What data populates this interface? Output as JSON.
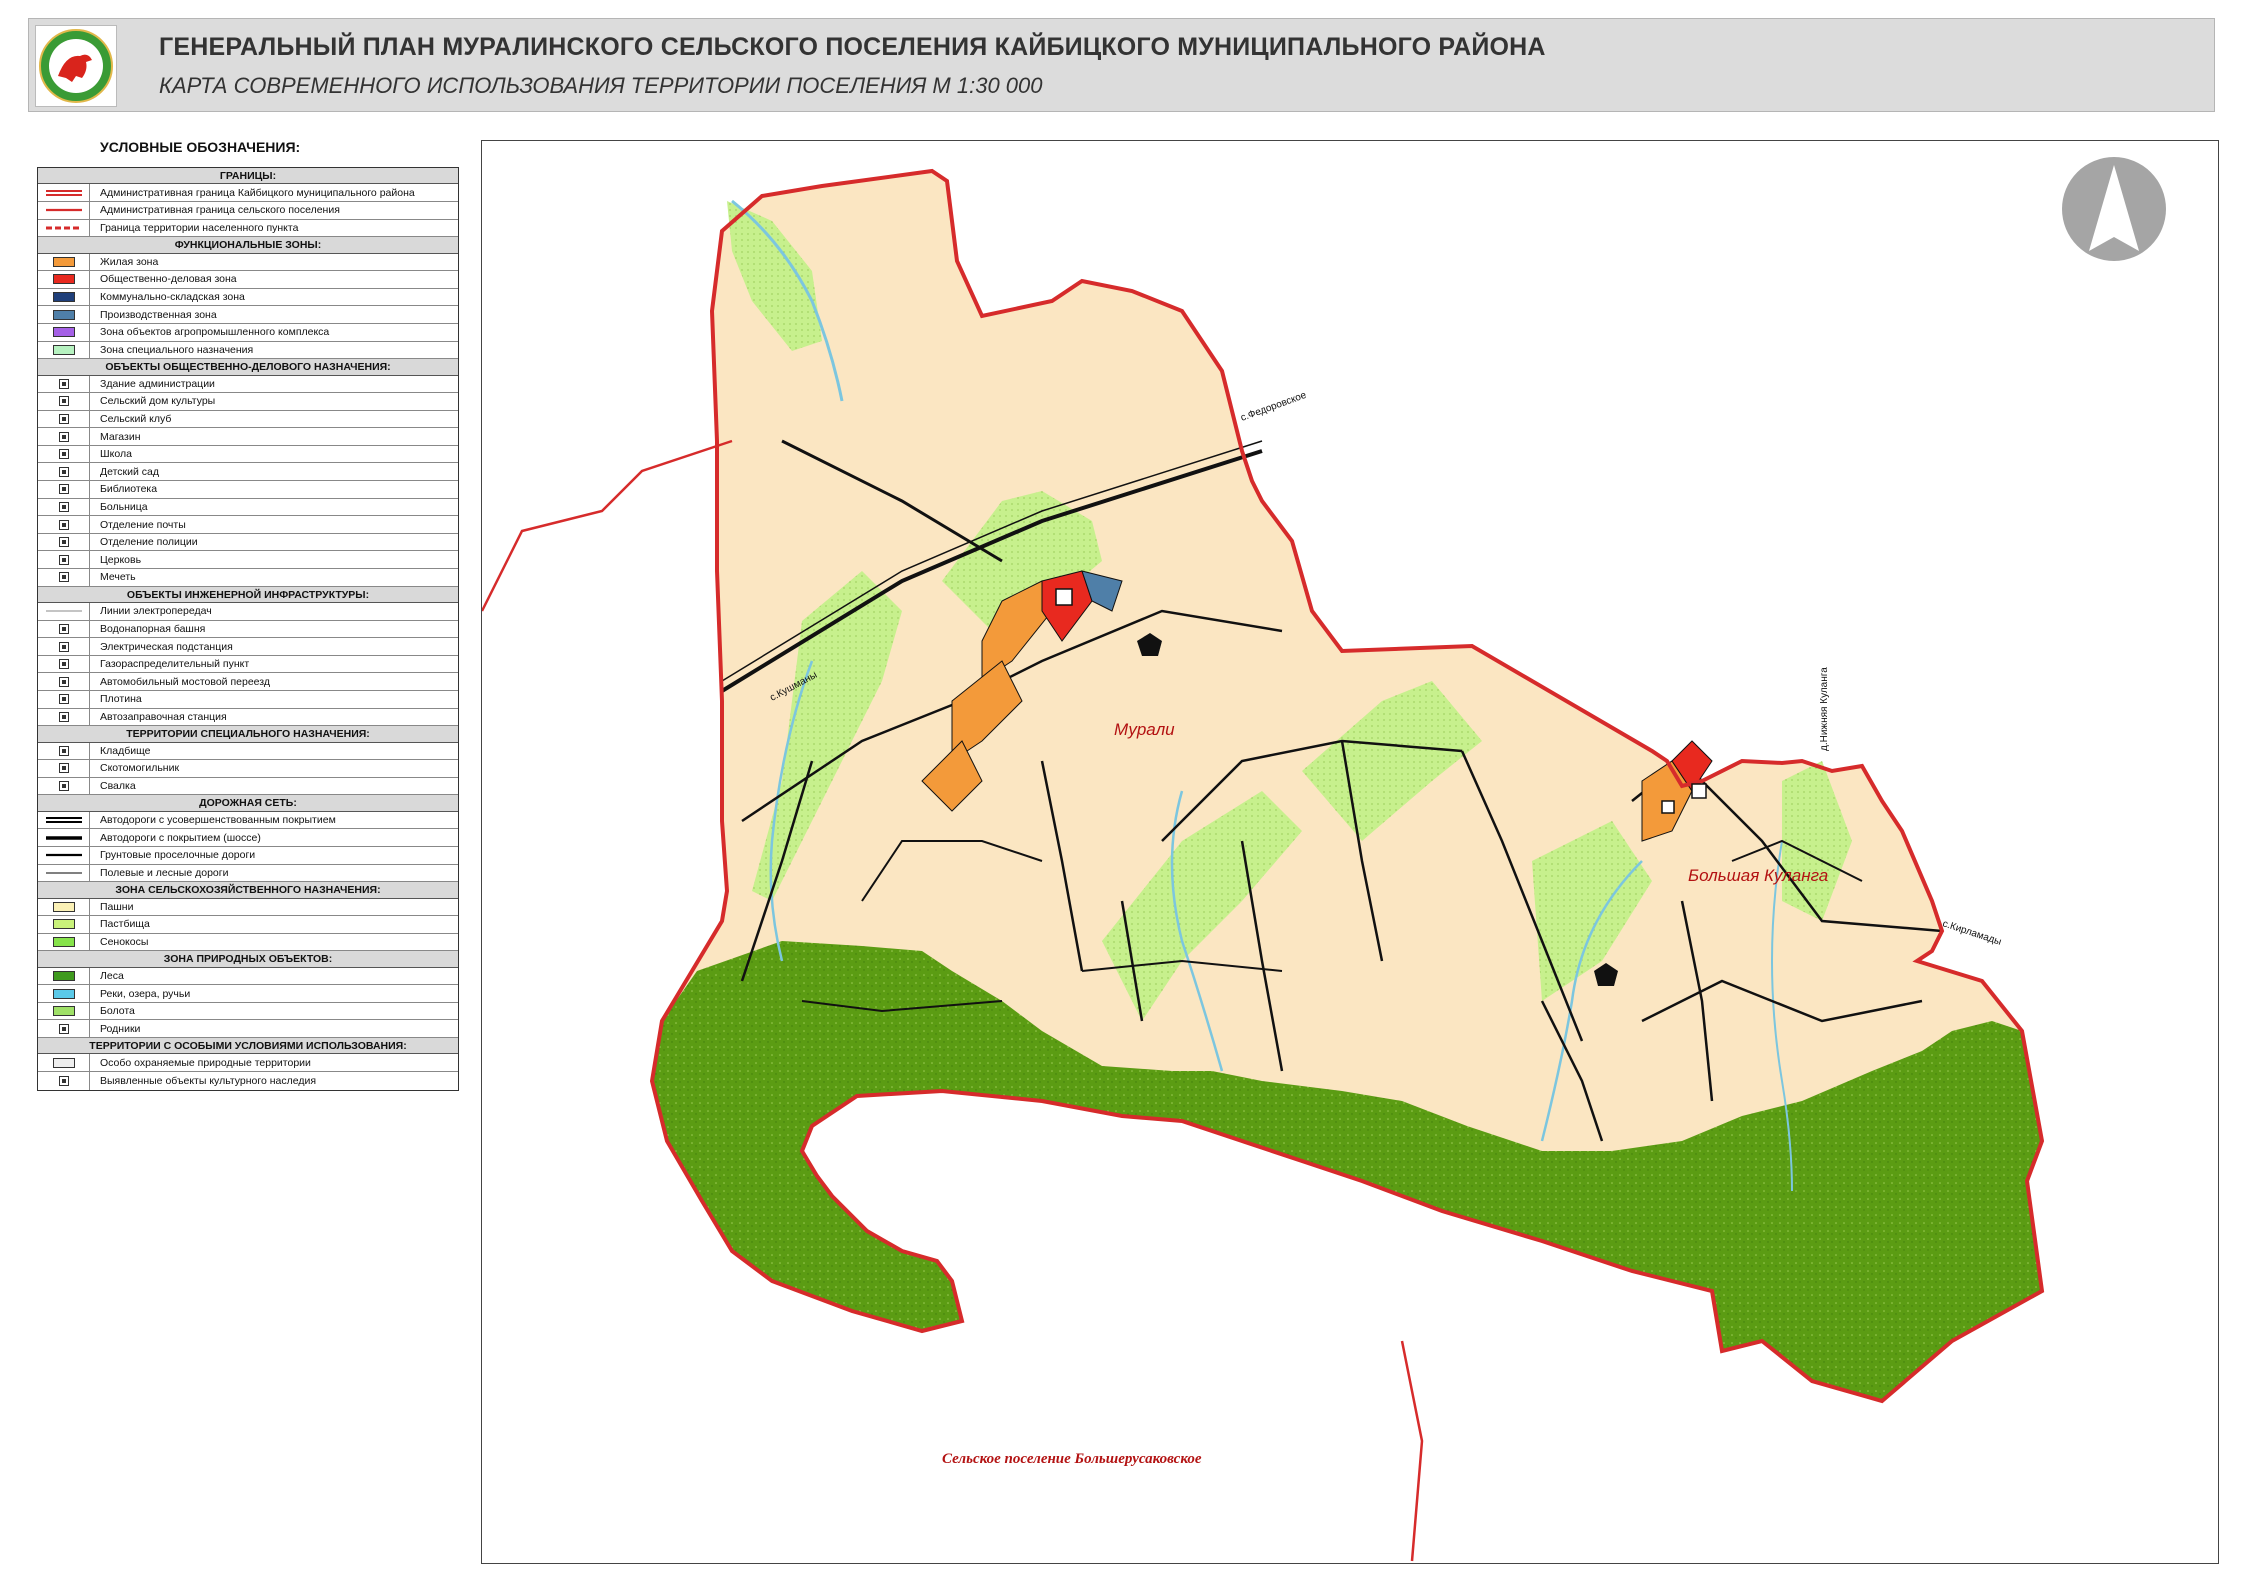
{
  "header": {
    "title": "ГЕНЕРАЛЬНЫЙ ПЛАН МУРАЛИНСКОГО СЕЛЬСКОГО ПОСЕЛЕНИЯ КАЙБИЦКОГО МУНИЦИПАЛЬНОГО РАЙОНА",
    "subtitle": "КАРТА СОВРЕМЕННОГО ИСПОЛЬЗОВАНИЯ ТЕРРИТОРИИ ПОСЕЛЕНИЯ М 1:30 000"
  },
  "legend": {
    "heading": "УСЛОВНЫЕ ОБОЗНАЧЕНИЯ:",
    "sections": [
      {
        "title": "ГРАНИЦЫ:",
        "items": [
          {
            "label": "Административная граница Кайбицкого муниципального района",
            "kind": "line",
            "color": "#d62b2b",
            "style": "double"
          },
          {
            "label": "Административная граница сельского поселения",
            "kind": "line",
            "color": "#d62b2b",
            "style": "solid"
          },
          {
            "label": "Граница территории населенного пункта",
            "kind": "line",
            "color": "#d62b2b",
            "style": "dashed"
          }
        ]
      },
      {
        "title": "ФУНКЦИОНАЛЬНЫЕ ЗОНЫ:",
        "items": [
          {
            "label": "Жилая зона",
            "kind": "box",
            "color": "#f39a3a"
          },
          {
            "label": "Общественно-деловая зона",
            "kind": "box",
            "color": "#e8291f"
          },
          {
            "label": "Коммунально-складская зона",
            "kind": "box",
            "color": "#1f3f7a"
          },
          {
            "label": "Производственная зона",
            "kind": "box",
            "color": "#4f7fa8"
          },
          {
            "label": "Зона объектов агропромышленного комплекса",
            "kind": "box",
            "color": "#a560e6"
          },
          {
            "label": "Зона специального назначения",
            "kind": "box",
            "color": "#b6f2c0"
          }
        ]
      },
      {
        "title": "ОБЪЕКТЫ ОБЩЕСТВЕННО-ДЕЛОВОГО НАЗНАЧЕНИЯ:",
        "items": [
          {
            "label": "Здание администрации",
            "kind": "icon",
            "icon": "administration-icon"
          },
          {
            "label": "Сельский дом культуры",
            "kind": "icon",
            "icon": "culture-house-icon"
          },
          {
            "label": "Сельский клуб",
            "kind": "icon",
            "icon": "club-icon"
          },
          {
            "label": "Магазин",
            "kind": "icon",
            "icon": "shop-icon"
          },
          {
            "label": "Школа",
            "kind": "icon",
            "icon": "school-icon"
          },
          {
            "label": "Детский сад",
            "kind": "icon",
            "icon": "kindergarten-icon"
          },
          {
            "label": "Библиотека",
            "kind": "icon",
            "icon": "library-icon"
          },
          {
            "label": "Больница",
            "kind": "icon",
            "icon": "hospital-icon"
          },
          {
            "label": "Отделение почты",
            "kind": "icon",
            "icon": "post-office-icon"
          },
          {
            "label": "Отделение полиции",
            "kind": "icon",
            "icon": "police-icon"
          },
          {
            "label": "Церковь",
            "kind": "icon",
            "icon": "church-icon"
          },
          {
            "label": "Мечеть",
            "kind": "icon",
            "icon": "mosque-icon"
          }
        ]
      },
      {
        "title": "ОБЪЕКТЫ ИНЖЕНЕРНОЙ ИНФРАСТРУКТУРЫ:",
        "items": [
          {
            "label": "Линии электропередач",
            "kind": "line",
            "color": "#888888",
            "style": "thin"
          },
          {
            "label": "Водонапорная башня",
            "kind": "icon",
            "icon": "water-tower-icon"
          },
          {
            "label": "Электрическая подстанция",
            "kind": "icon",
            "icon": "substation-icon"
          },
          {
            "label": "Газораспределительный пункт",
            "kind": "icon",
            "icon": "gas-point-icon"
          },
          {
            "label": "Автомобильный мостовой переезд",
            "kind": "icon",
            "icon": "bridge-icon"
          },
          {
            "label": "Плотина",
            "kind": "icon",
            "icon": "dam-icon"
          },
          {
            "label": "Автозаправочная станция",
            "kind": "icon",
            "icon": "fuel-station-icon"
          }
        ]
      },
      {
        "title": "ТЕРРИТОРИИ СПЕЦИАЛЬНОГО НАЗНАЧЕНИЯ:",
        "items": [
          {
            "label": "Кладбище",
            "kind": "icon",
            "icon": "cemetery-icon"
          },
          {
            "label": "Скотомогильник",
            "kind": "icon",
            "icon": "cattle-burial-icon"
          },
          {
            "label": "Свалка",
            "kind": "icon",
            "icon": "landfill-icon"
          }
        ]
      },
      {
        "title": "ДОРОЖНАЯ СЕТЬ:",
        "items": [
          {
            "label": "Автодороги с усовершенствованным покрытием",
            "kind": "line",
            "color": "#000000",
            "style": "double"
          },
          {
            "label": "Автодороги с покрытием (шоссе)",
            "kind": "line",
            "color": "#000000",
            "style": "thick"
          },
          {
            "label": "Грунтовые проселочные дороги",
            "kind": "line",
            "color": "#000000",
            "style": "solid"
          },
          {
            "label": "Полевые и лесные дороги",
            "kind": "line",
            "color": "#000000",
            "style": "thin"
          }
        ]
      },
      {
        "title": "ЗОНА СЕЛЬСКОХОЗЯЙСТВЕННОГО НАЗНАЧЕНИЯ:",
        "items": [
          {
            "label": "Пашни",
            "kind": "box",
            "color": "#fbf1b6"
          },
          {
            "label": "Пастбища",
            "kind": "box",
            "color": "#c9f27a"
          },
          {
            "label": "Сенокосы",
            "kind": "box",
            "color": "#86e34a"
          }
        ]
      },
      {
        "title": "ЗОНА ПРИРОДНЫХ ОБЪЕКТОВ:",
        "items": [
          {
            "label": "Леса",
            "kind": "box",
            "color": "#3f9a1e"
          },
          {
            "label": "Реки, озера, ручьи",
            "kind": "box",
            "color": "#5bc9e8"
          },
          {
            "label": "Болота",
            "kind": "box",
            "color": "#9fe067"
          },
          {
            "label": "Родники",
            "kind": "icon",
            "icon": "spring-icon"
          }
        ]
      },
      {
        "title": "ТЕРРИТОРИИ С ОСОБЫМИ УСЛОВИЯМИ ИСПОЛЬЗОВАНИЯ:",
        "items": [
          {
            "label": "Особо охраняемые природные территории",
            "kind": "box",
            "color": "#eeeeee"
          },
          {
            "label": "Выявленные объекты культурного наследия",
            "kind": "icon",
            "icon": "heritage-icon"
          }
        ]
      }
    ]
  },
  "map": {
    "settlements": [
      {
        "name": "Мурали"
      },
      {
        "name": "Большая Куланга"
      }
    ],
    "neighbor": "Сельское поселение Большерусаковское",
    "road_labels": [
      "с.Кушманы",
      "с.Федоровское",
      "д.Нижняя Куланга",
      "с.Кирламады"
    ],
    "colors": {
      "arable": "#fbe6c2",
      "forest": "#5b9c13",
      "pasture": "#c7f08d",
      "boundary": "#d62b2b",
      "river": "#7cc6df"
    }
  }
}
